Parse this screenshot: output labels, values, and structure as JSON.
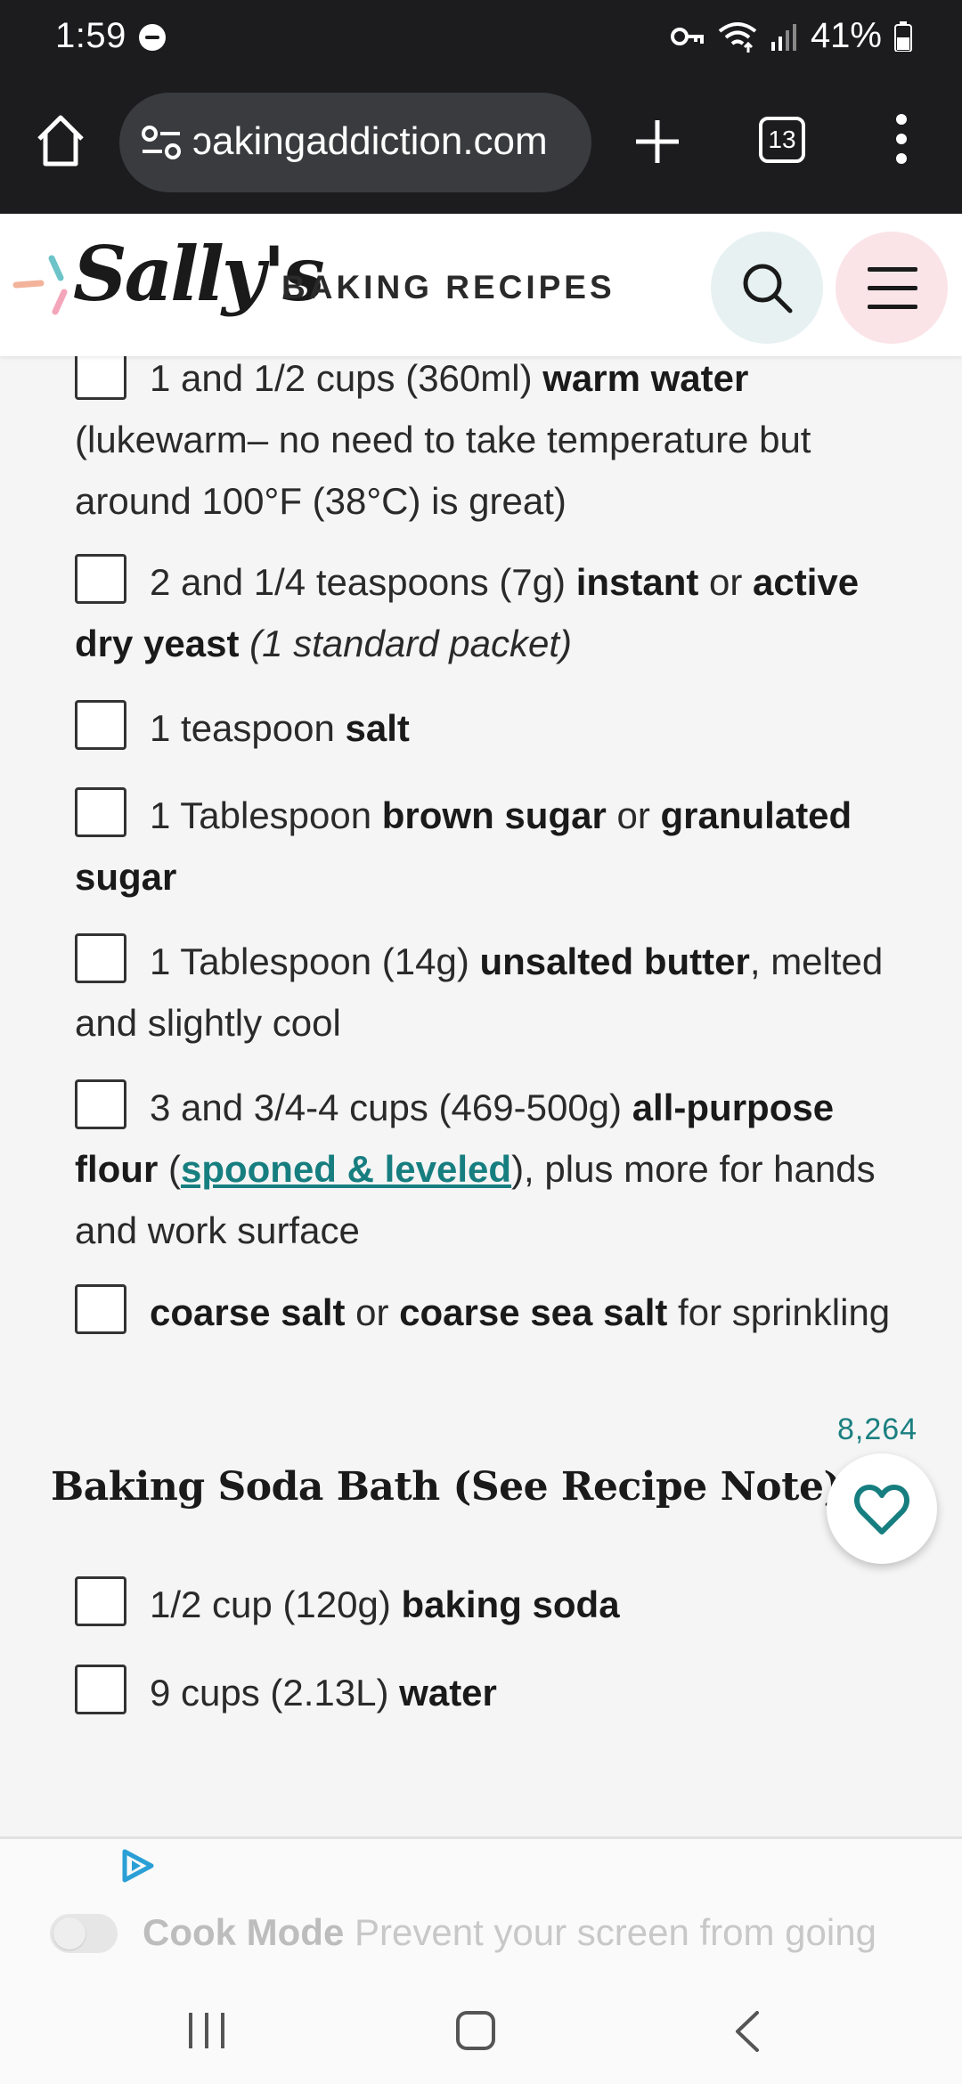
{
  "status": {
    "time": "1:59",
    "battery": "41%"
  },
  "browser": {
    "url": "ɔakingaddiction.com",
    "tab_count": "13"
  },
  "header": {
    "logo_script": "Sally's",
    "logo_sub": "BAKING RECIPES"
  },
  "ingredients": [
    {
      "parts": [
        {
          "t": "1 and 1/2 cups (360ml) ",
          "s": "n"
        },
        {
          "t": "warm water",
          "s": "b"
        },
        {
          "t": " (lukewarm– no need to take temperature but around 100°F (38°C) is great)",
          "s": "n"
        }
      ]
    },
    {
      "parts": [
        {
          "t": "2 and 1/4 teaspoons (7g) ",
          "s": "n"
        },
        {
          "t": "instant",
          "s": "b"
        },
        {
          "t": " or ",
          "s": "n"
        },
        {
          "t": "active dry yeast",
          "s": "b"
        },
        {
          "t": " ",
          "s": "n"
        },
        {
          "t": "(1 standard packet)",
          "s": "i"
        }
      ]
    },
    {
      "parts": [
        {
          "t": "1 teaspoon ",
          "s": "n"
        },
        {
          "t": "salt",
          "s": "b"
        }
      ]
    },
    {
      "parts": [
        {
          "t": "1 Tablespoon ",
          "s": "n"
        },
        {
          "t": "brown sugar",
          "s": "b"
        },
        {
          "t": " or ",
          "s": "n"
        },
        {
          "t": "granulated sugar",
          "s": "b"
        }
      ]
    },
    {
      "parts": [
        {
          "t": "1 Tablespoon (14g) ",
          "s": "n"
        },
        {
          "t": "unsalted butter",
          "s": "b"
        },
        {
          "t": ", melted and slightly cool",
          "s": "n"
        }
      ]
    },
    {
      "parts": [
        {
          "t": "3 and 3/4-4 cups (469-500g) ",
          "s": "n"
        },
        {
          "t": "all-purpose flour",
          "s": "b"
        },
        {
          "t": " (",
          "s": "n"
        },
        {
          "t": "spooned & leveled",
          "s": "a"
        },
        {
          "t": "), plus more for hands and work surface",
          "s": "n"
        }
      ]
    },
    {
      "parts": [
        {
          "t": "coarse salt",
          "s": "b"
        },
        {
          "t": " or ",
          "s": "n"
        },
        {
          "t": "coarse sea salt",
          "s": "b"
        },
        {
          "t": " for sprinkling",
          "s": "n"
        }
      ]
    }
  ],
  "section": {
    "title": "Baking Soda Bath (See Recipe Note)"
  },
  "bath_ingredients": [
    {
      "parts": [
        {
          "t": "1/2 cup (120g) ",
          "s": "n"
        },
        {
          "t": "baking soda",
          "s": "b"
        }
      ]
    },
    {
      "parts": [
        {
          "t": "9 cups (2.13L) ",
          "s": "n"
        },
        {
          "t": "water",
          "s": "b"
        }
      ]
    }
  ],
  "favorite": {
    "count": "8,264"
  },
  "cook_mode": {
    "label": "Cook Mode",
    "description": "Prevent your screen from going dark"
  },
  "colors": {
    "accent": "#177e80",
    "search_bg": "#e7f1f2",
    "menu_bg": "#fbe4e8"
  },
  "icons": [
    "home-icon",
    "tune-icon",
    "plus-icon",
    "tabs-icon",
    "more-vert-icon",
    "search-icon",
    "hamburger-icon",
    "heart-icon",
    "ad-choices-icon",
    "recents-icon",
    "nav-home-icon",
    "back-icon"
  ]
}
